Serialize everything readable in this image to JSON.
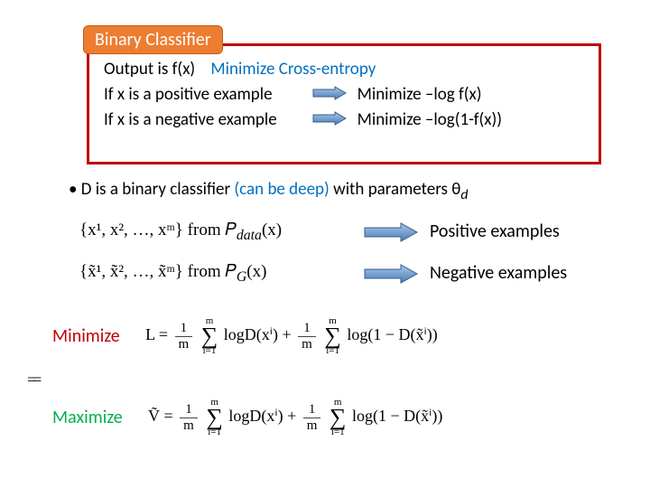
{
  "badge": "Binary Classifier",
  "box": {
    "l1a": "Output is f(x)",
    "l1b": "Minimize Cross-entropy",
    "l2a": "If x is a positive example",
    "l2b": "Minimize –log f(x)",
    "l3a": "If x is a negative example",
    "l3b": "Minimize –log(1-f(x))"
  },
  "dline_a": "D is a binary classifier ",
  "dline_b": "(can be deep)",
  "dline_c": " with parameters θ",
  "dline_d": "d",
  "ex1_set": "{x¹, x², …, xᵐ} from 𝑃",
  "ex1_sub": "data",
  "ex1_arg": "(x)",
  "ex2_set": "{x̃¹, x̃², …, x̃ᵐ} from 𝑃",
  "ex2_sub": "G",
  "ex2_arg": "(x)",
  "pos_label": "Positive examples",
  "neg_label": "Negative examples",
  "min_word": "Minimize",
  "max_word": "Maximize",
  "L_eq_lhs": "L =",
  "V_eq_lhs": "Ṽ =",
  "frac1_n": "1",
  "frac1_d": "m",
  "sum_top": "m",
  "sum_sym": "∑",
  "sum_bot": "i=1",
  "term1": " logD(xⁱ) + ",
  "term2": " log(1 − D(x̃ⁱ))",
  "equiv": "=="
}
